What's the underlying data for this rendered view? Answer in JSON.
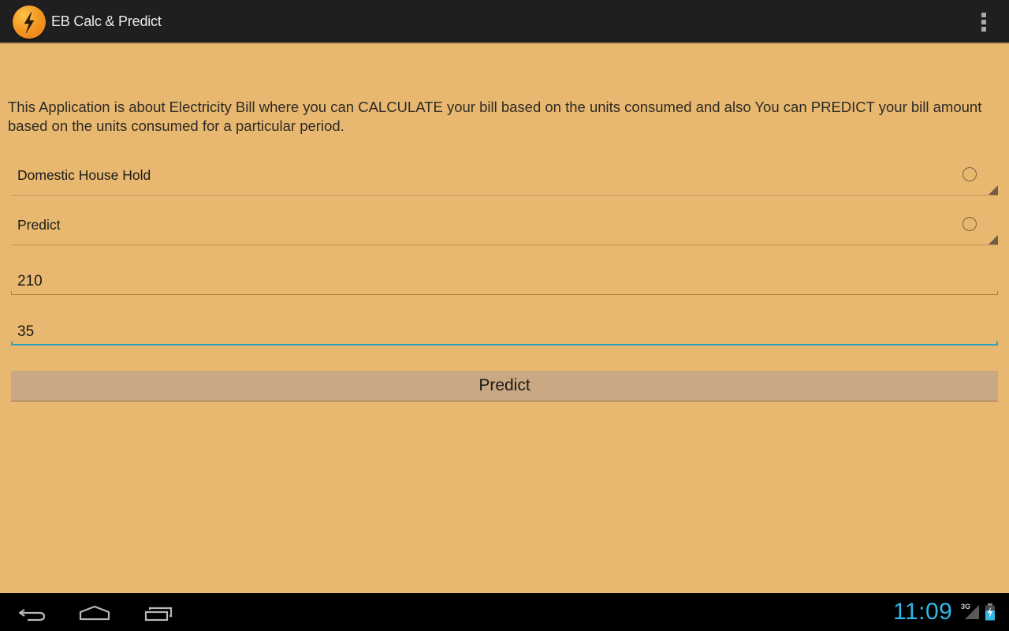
{
  "app": {
    "title": "EB Calc & Predict",
    "icon": "lightning-bolt-icon",
    "menu_icon": "overflow-menu-icon"
  },
  "main": {
    "description": "This Application is about Electricity Bill where you can CALCULATE your bill based on the units consumed and also You can PREDICT your bill amount based on the units consumed for a particular period.",
    "consumer_type_spinner": {
      "selected": "Domestic House Hold"
    },
    "mode_spinner": {
      "selected": "Predict"
    },
    "units_field": {
      "value": "210"
    },
    "days_field": {
      "value": "35",
      "focused": true
    },
    "predict_button": {
      "label": "Predict"
    }
  },
  "colors": {
    "background": "#e8b870",
    "action_bar": "#1f1f1f",
    "focus_accent": "#2a9fc4",
    "button_bg": "#c9a883",
    "clock": "#33b5e5"
  },
  "system_bar": {
    "nav_buttons": [
      "back-icon",
      "home-icon",
      "recent-apps-icon"
    ],
    "clock": "11:09",
    "network": "3G",
    "battery": "charging"
  }
}
